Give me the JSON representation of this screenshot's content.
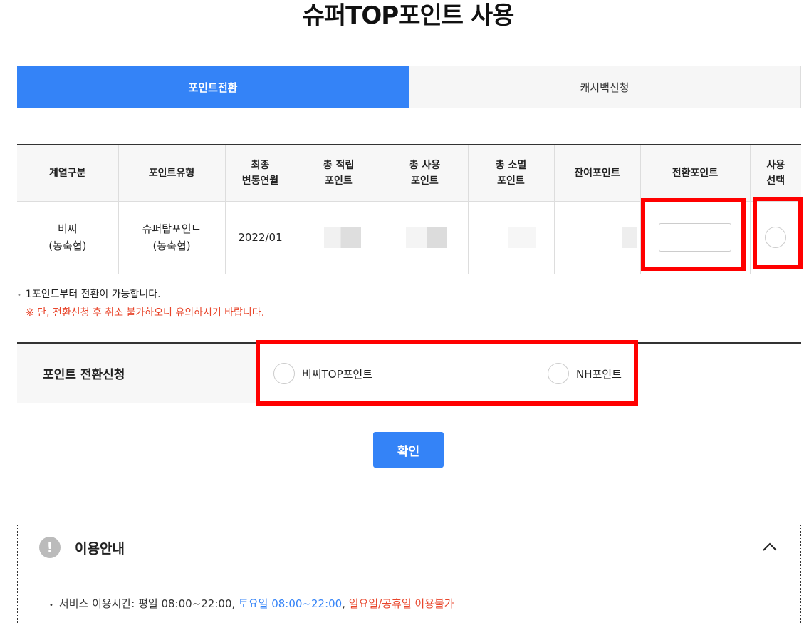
{
  "page": {
    "title": "슈퍼TOP포인트 사용"
  },
  "tabs": [
    {
      "label": "포인트전환",
      "active": true
    },
    {
      "label": "캐시백신청",
      "active": false
    }
  ],
  "table": {
    "headers": {
      "affiliate": "계열구분",
      "point_type": "포인트유형",
      "last_change_l1": "최종",
      "last_change_l2": "변동연월",
      "total_earned_l1": "총 적립",
      "total_earned_l2": "포인트",
      "total_used_l1": "총 사용",
      "total_used_l2": "포인트",
      "total_expired_l1": "총 소멸",
      "total_expired_l2": "포인트",
      "remaining": "잔여포인트",
      "convert": "전환포인트",
      "select_l1": "사용",
      "select_l2": "선택"
    },
    "row": {
      "affiliate_l1": "비씨",
      "affiliate_l2": "(농축협)",
      "type_l1": "슈퍼탑포인트",
      "type_l2": "(농축협)",
      "last_change": "2022/01",
      "convert_value": ""
    }
  },
  "notes": {
    "note1": "1포인트부터 전환이 가능합니다.",
    "note2": "※ 단, 전환신청 후 취소 불가하오니 유의하시기 바랍니다."
  },
  "apply": {
    "label": "포인트 전환신청",
    "option1": "비씨TOP포인트",
    "option2": "NH포인트"
  },
  "confirm_label": "확인",
  "guide": {
    "title": "이용안내",
    "line_prefix": "서비스 이용시간: 평일 08:00~22:00, ",
    "line_blue": "토요일 08:00~22:00",
    "line_comma": ", ",
    "line_red": "일요일/공휴일 이용불가"
  },
  "colors": {
    "accent": "#3483f7",
    "warning": "#e8452b",
    "highlight": "#ff0000"
  }
}
